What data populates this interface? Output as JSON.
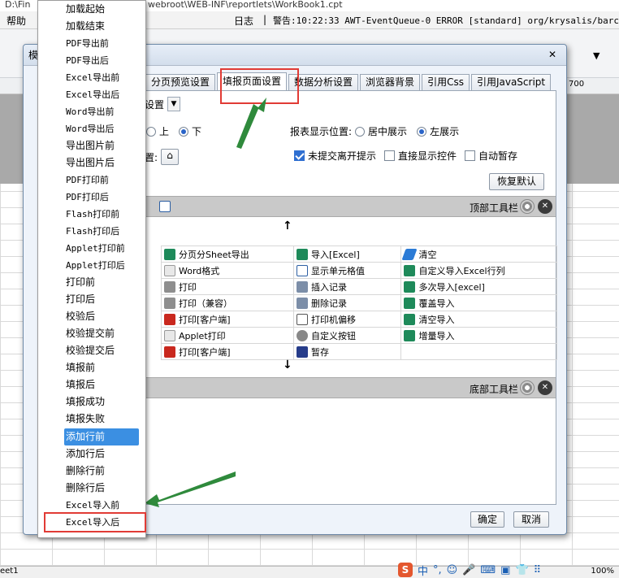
{
  "window": {
    "title_path": "D:\\Fin",
    "title_path2": "webroot\\WEB-INF\\reportlets\\WorkBook1.cpt"
  },
  "menubar": {
    "help": "帮助",
    "log": "日志",
    "sep": "|",
    "log_message": "警告:10:22:33 AWT-EventQueue-0 ERROR [standard] org/krysalis/barcod"
  },
  "ruler": {
    "mark_700": "700"
  },
  "statusbar": {
    "sheet": "eet1",
    "zoom": "100%",
    "ime_items": [
      "中",
      "°,",
      "☺",
      "🎤",
      "⌨",
      "▣",
      "👕",
      "⠿"
    ]
  },
  "dialog": {
    "title": "模",
    "tabs": [
      {
        "label": "分页预览设置",
        "active": false
      },
      {
        "label": "填报页面设置",
        "active": true
      },
      {
        "label": "数据分析设置",
        "active": false
      },
      {
        "label": "浏览器背景",
        "active": false
      },
      {
        "label": "引用Css",
        "active": false
      },
      {
        "label": "引用JavaScript",
        "active": false
      }
    ],
    "setting_dropdown_label": "设置",
    "position_label_tail": "置:",
    "radio_up": "上",
    "radio_down": "下",
    "report_position_label": "报表显示位置:",
    "center_label": "居中展示",
    "left_label": "左展示",
    "check_unsubmitted": "未提交离开提示",
    "check_direct": "直接显示控件",
    "check_autosave": "自动暂存",
    "restore_default": "恢复默认",
    "top_toolbar": "顶部工具栏",
    "bottom_toolbar": "底部工具栏",
    "arrow_up": "↑",
    "arrow_down": "↓",
    "grid": [
      [
        "分页分Sheet导出",
        "导入[Excel]",
        "清空"
      ],
      [
        "Word格式",
        "显示单元格值",
        "自定义导入Excel行列"
      ],
      [
        "打印",
        "插入记录",
        "多次导入[excel]"
      ],
      [
        "打印（兼容）",
        "删除记录",
        "覆盖导入"
      ],
      [
        "打印[客户端]",
        "打印机偏移",
        "清空导入"
      ],
      [
        "Applet打印",
        "自定义按钮",
        "增量导入"
      ],
      [
        "打印[客户端]",
        "暂存",
        ""
      ]
    ],
    "ok": "确定",
    "cancel": "取消"
  },
  "popup": {
    "items": [
      "加载起始",
      "加载结束",
      "PDF导出前",
      "PDF导出后",
      "Excel导出前",
      "Excel导出后",
      "Word导出前",
      "Word导出后",
      "导出图片前",
      "导出图片后",
      "PDF打印前",
      "PDF打印后",
      "Flash打印前",
      "Flash打印后",
      "Applet打印前",
      "Applet打印后",
      "打印前",
      "打印后",
      "校验后",
      "校验提交前",
      "校验提交后",
      "填报前",
      "填报后",
      "填报成功",
      "填报失败",
      "添加行前",
      "添加行后",
      "删除行前",
      "删除行后",
      "Excel导入前",
      "Excel导入后"
    ],
    "selected_index": 25,
    "highlighted_index": 30
  },
  "colors": {
    "annotation": "#e13b35",
    "arrow": "#2f8a3c",
    "selection": "#3b8fe2"
  }
}
